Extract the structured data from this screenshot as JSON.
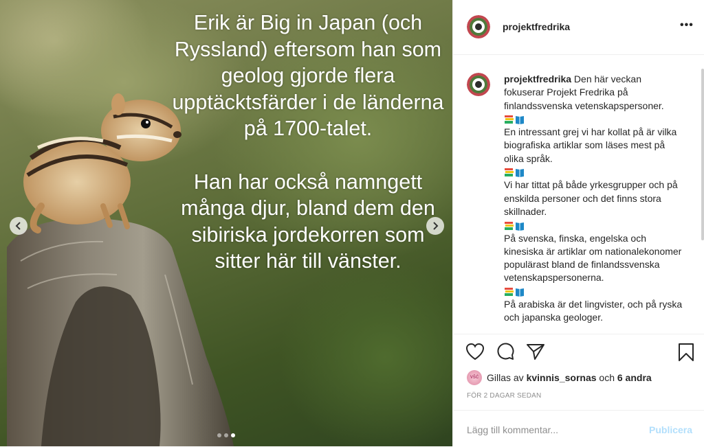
{
  "post": {
    "overlay_text": "Erik är Big in Japan (och Ryssland) eftersom han som geolog gjorde flera upptäcktsfärder i de länderna på 1700-talet.\n\nHan har också namngett många djur, bland dem den sibiriska jordekorren som sitter här till vänster.",
    "carousel": {
      "dots": 3,
      "active": 3
    }
  },
  "header": {
    "username": "projektfredrika",
    "more": "•••"
  },
  "caption": {
    "username": "projektfredrika",
    "lines": [
      " Den här veckan fokuserar Projekt Fredrika på finlandssvenska vetenskapspersoner.",
      "En intressant grej vi har kollat på är vilka biografiska artiklar som läses mest på olika språk.",
      "Vi har tittat på både yrkesgrupper och på enskilda personer och det finns stora skillnader.",
      "På svenska, finska, engelska och kinesiska är artiklar om nationalekonomer populärast bland de finlandssvenska vetenskapspersonerna.",
      "På arabiska är det lingvister, och på ryska och japanska geologer."
    ],
    "emoji": "books-emoji"
  },
  "likes": {
    "prefix": "Gillas av ",
    "user": "kvinnis_sornas",
    "middle": " och ",
    "others": "6 andra"
  },
  "timestamp": "FÖR 2 DAGAR SEDAN",
  "comment": {
    "placeholder": "Lägg till kommentar...",
    "publish": "Publicera"
  },
  "colors": {
    "text": "#262626",
    "muted": "#8e8e8e",
    "publish_disabled": "#b2dffc",
    "divider": "#efefef"
  }
}
